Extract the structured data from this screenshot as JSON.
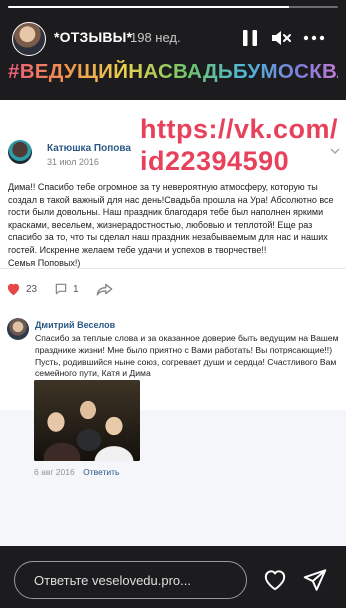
{
  "story": {
    "segments_total": 1,
    "segment_progress": 0.85,
    "account_name": "*ОТЗЫВЫ*",
    "age": "198 нед.",
    "controls": {
      "pause_icon": "pause-icon",
      "mute_icon": "mute-icon",
      "more_icon": "more-icon"
    }
  },
  "hashtag": "#ВЕДУЩИЙНАСВАДЬБУМОСКВА",
  "overlay": {
    "line1": "https://vk.com/",
    "line2": "id22394590",
    "color": "#e8415c"
  },
  "post": {
    "author": "Катюшка Попова",
    "date": "31 июл 2016",
    "text": "Дима!! Спасибо тебе огромное за ту невероятную атмосферу, которую ты создал в такой важный для нас день!Свадьба прошла на Ура! Абсолютно все гости были довольны. Наш праздник благодаря тебе был наполнен яркими красками, весельем, жизнерадостностью, любовью и теплотой! Еще раз спасибо за то, что ты сделал наш праздник незабываемым для нас и наших гостей. Искренне желаем тебе удачи и успехов в творчестве!!",
    "signature": "Семья Поповых!)",
    "likes": "23",
    "comments": "1"
  },
  "comment": {
    "author": "Дмитрий Веселов",
    "text": "Спасибо за теплые слова и за оказанное доверие быть ведущим на Вашем празднике жизни! Мне было приятно с Вами работать! Вы потрясающие!!) Пусть, родившийся ныне союз, согревает души и сердца! Счастливого Вам семейного пути, Катя и Дима",
    "date": "6 авг 2016",
    "reply_label": "Ответить"
  },
  "reply_bar": {
    "placeholder": "Ответьте veselovedu.pro...",
    "like_icon": "heart-icon",
    "send_icon": "send-icon"
  },
  "colors": {
    "vk_link": "#2a5885",
    "like_red": "#e64646",
    "accent_pink": "#e8415c"
  }
}
